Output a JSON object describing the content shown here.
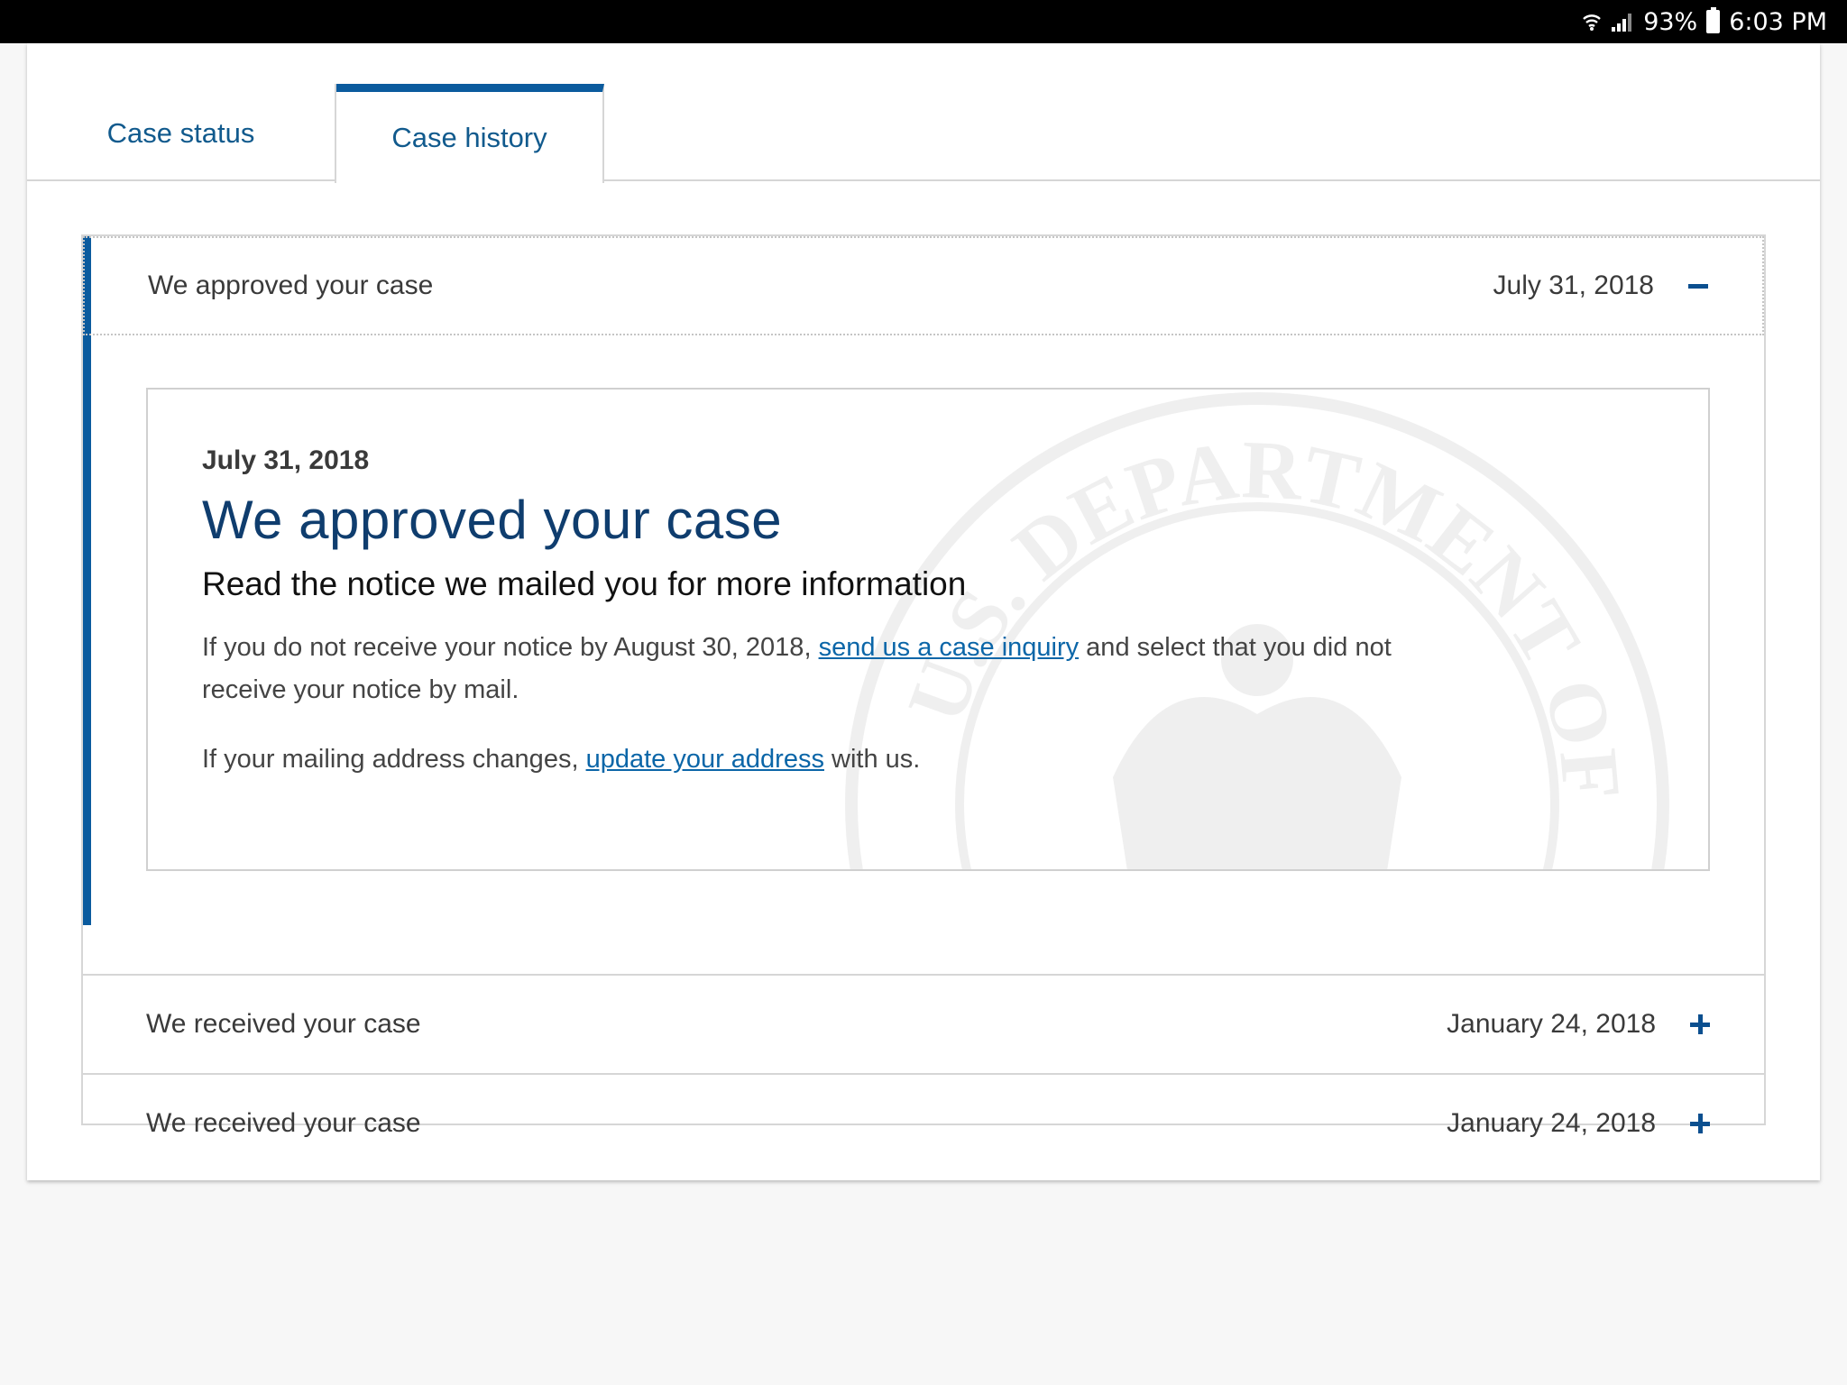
{
  "status_bar": {
    "battery": "93%",
    "time": "6:03 PM"
  },
  "tabs": [
    {
      "label": "Case status"
    },
    {
      "label": "Case history"
    }
  ],
  "history": {
    "expanded": {
      "title": "We approved your case",
      "date": "July 31, 2018",
      "detail": {
        "date": "July 31, 2018",
        "title": "We approved your case",
        "subtitle": "Read the notice we mailed you for more information",
        "para1_before": "If you do not receive your notice by August 30, 2018, ",
        "para1_link": "send us a case inquiry",
        "para1_after": " and select that you did not receive your notice by mail.",
        "para2_before": "If your mailing address changes, ",
        "para2_link": "update your address",
        "para2_after": " with us."
      }
    },
    "items": [
      {
        "title": "We received your case",
        "date": "January 24, 2018"
      },
      {
        "title": "We received your case",
        "date": "January 24, 2018"
      }
    ]
  },
  "seal_text": "U.S. DEPARTMENT OF",
  "colors": {
    "accent": "#0b5b9e",
    "link": "#0b66a8",
    "heading": "#0f3d6e"
  }
}
